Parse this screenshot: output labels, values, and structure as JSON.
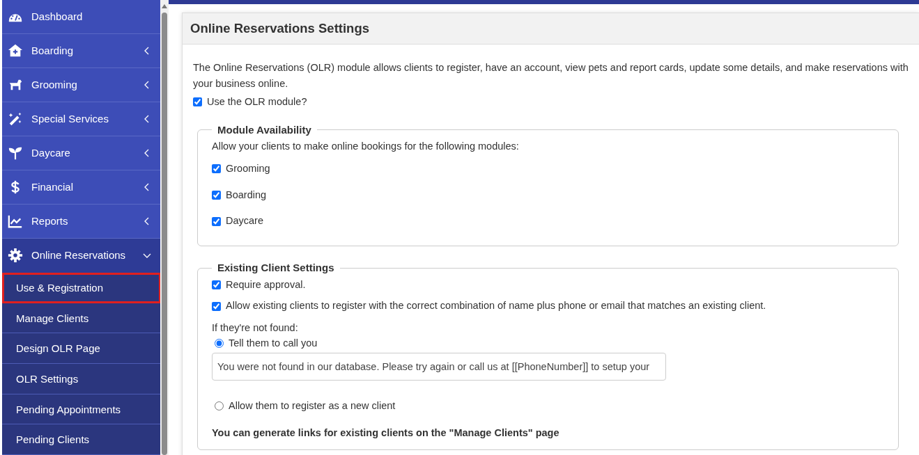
{
  "sidebar": {
    "items": [
      {
        "label": "Dashboard",
        "kind": "link"
      },
      {
        "label": "Boarding",
        "kind": "group",
        "expanded": false
      },
      {
        "label": "Grooming",
        "kind": "group",
        "expanded": false
      },
      {
        "label": "Special Services",
        "kind": "group",
        "expanded": false
      },
      {
        "label": "Daycare",
        "kind": "group",
        "expanded": false
      },
      {
        "label": "Financial",
        "kind": "group",
        "expanded": false
      },
      {
        "label": "Reports",
        "kind": "group",
        "expanded": false
      },
      {
        "label": "Online Reservations",
        "kind": "group",
        "expanded": true,
        "children": [
          {
            "label": "Use & Registration",
            "selected": true
          },
          {
            "label": "Manage Clients",
            "selected": false
          },
          {
            "label": "Design OLR Page",
            "selected": false
          },
          {
            "label": "OLR Settings",
            "selected": false
          },
          {
            "label": "Pending Appointments",
            "selected": false
          },
          {
            "label": "Pending Clients",
            "selected": false
          }
        ]
      }
    ]
  },
  "panel": {
    "title": "Online Reservations Settings",
    "intro": "The Online Reservations (OLR) module allows clients to register, have an account, view pets and report cards, update some details, and make reservations with your business online.",
    "use_olr": {
      "label": "Use the OLR module?",
      "checked": true
    },
    "module_availability": {
      "legend": "Module Availability",
      "prompt": "Allow your clients to make online bookings for the following modules:",
      "options": [
        {
          "label": "Grooming",
          "checked": true
        },
        {
          "label": "Boarding",
          "checked": true
        },
        {
          "label": "Daycare",
          "checked": true
        }
      ]
    },
    "existing_client_settings": {
      "legend": "Existing Client Settings",
      "checks": [
        {
          "label": "Require approval.",
          "checked": true
        },
        {
          "label": "Allow existing clients to register with the correct combination of name plus phone or email that matches an existing client.",
          "checked": true
        }
      ],
      "not_found_label": "If they're not found:",
      "radios": [
        {
          "label": "Tell them to call you",
          "selected": true
        },
        {
          "label": "Allow them to register as a new client",
          "selected": false
        }
      ],
      "message_value": "You were not found in our database. Please try again or call us at [[PhoneNumber]] to setup your",
      "note": "You can generate links for existing clients on the \"Manage Clients\" page"
    }
  }
}
